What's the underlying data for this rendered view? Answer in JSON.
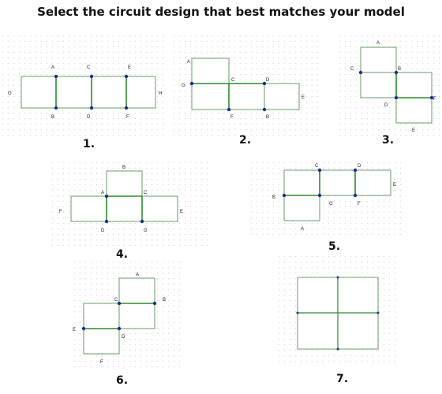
{
  "page": {
    "title": "Select the circuit design that best matches your model"
  },
  "colors": {
    "grid_dot": "#d7d7d7",
    "cell_stroke": "#6a9a6a",
    "wire": "#2e8a2e",
    "node": "#1d2e8f",
    "label": "#222222"
  },
  "options": [
    {
      "number": "1.",
      "labels": [
        "A",
        "C",
        "E",
        "G",
        "H",
        "B",
        "D",
        "F"
      ]
    },
    {
      "number": "2.",
      "labels": [
        "A",
        "G",
        "C",
        "D",
        "E",
        "F",
        "B"
      ]
    },
    {
      "number": "3.",
      "labels": [
        "A",
        "C",
        "B",
        "D",
        "F",
        "E"
      ]
    },
    {
      "number": "4.",
      "labels": [
        "B",
        "A",
        "C",
        "F",
        "E",
        "D",
        "G"
      ]
    },
    {
      "number": "5.",
      "labels": [
        "C",
        "D",
        "E",
        "B",
        "G",
        "F",
        "A"
      ]
    },
    {
      "number": "6.",
      "labels": [
        "A",
        "C",
        "B",
        "E",
        "D",
        "F"
      ]
    },
    {
      "number": "7.",
      "labels": []
    }
  ]
}
